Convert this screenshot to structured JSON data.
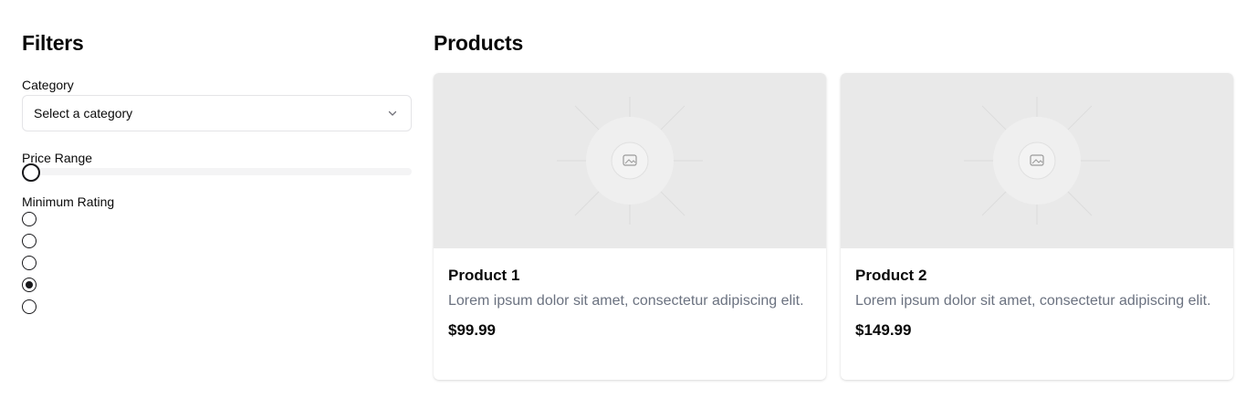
{
  "filters": {
    "title": "Filters",
    "category": {
      "label": "Category",
      "placeholder": "Select a category"
    },
    "price_range": {
      "label": "Price Range",
      "value_fraction": 0.0
    },
    "minimum_rating": {
      "label": "Minimum Rating",
      "options_count": 5,
      "selected_index": 3
    }
  },
  "products": {
    "title": "Products",
    "items": [
      {
        "name": "Product 1",
        "description": "Lorem ipsum dolor sit amet, consectetur adipiscing elit.",
        "price": "$99.99"
      },
      {
        "name": "Product 2",
        "description": "Lorem ipsum dolor sit amet, consectetur adipiscing elit.",
        "price": "$149.99"
      }
    ]
  },
  "icons": {
    "select_chevron": "chevron-down-icon",
    "image_placeholder": "image-placeholder-icon"
  },
  "colors": {
    "primary": "#18181b",
    "muted_text": "#6b7280",
    "media_bg": "#e9e9e9",
    "border": "#e4e4e7"
  }
}
